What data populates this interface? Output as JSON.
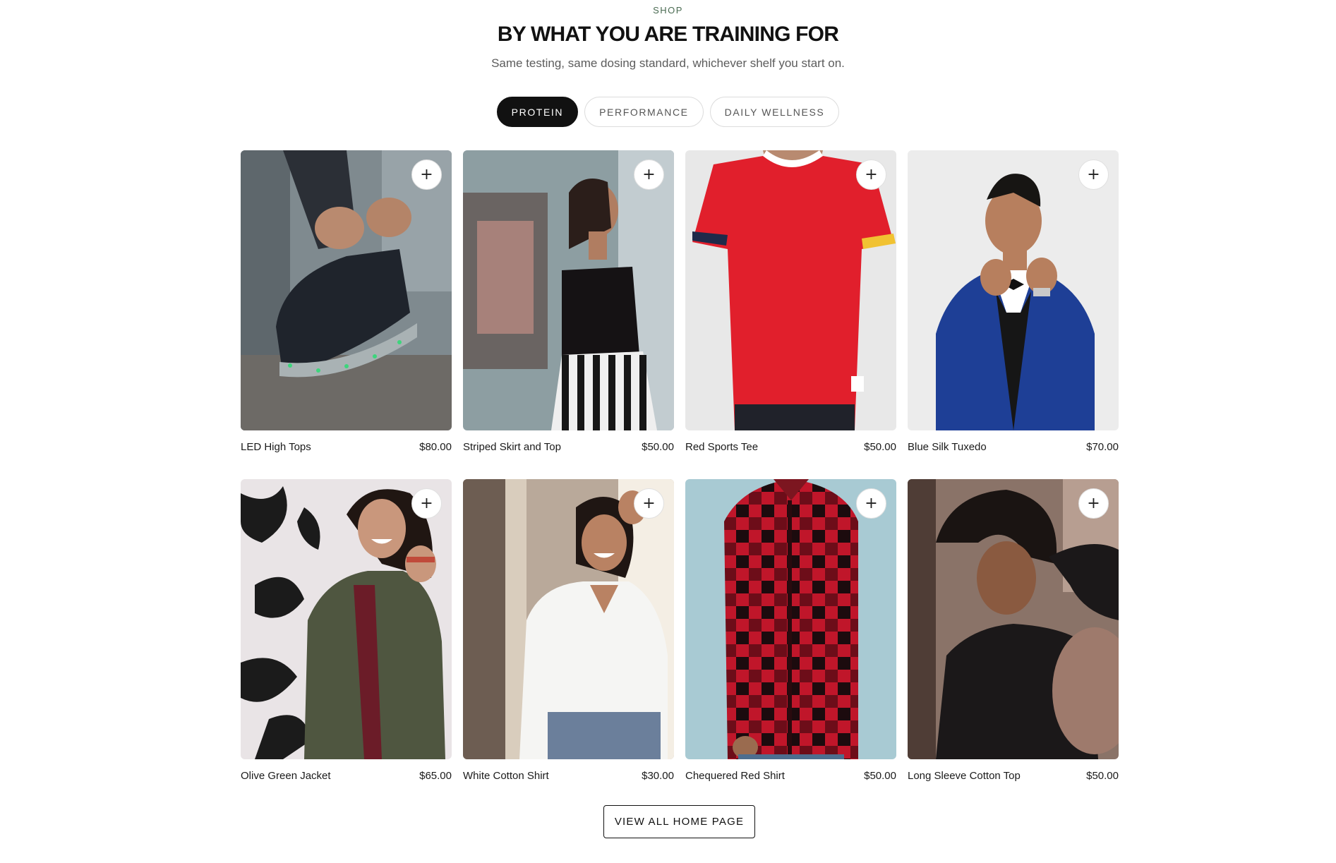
{
  "header": {
    "eyebrow": "SHOP",
    "title": "BY WHAT YOU ARE TRAINING FOR",
    "subtitle": "Same testing, same dosing standard, whichever shelf you start on."
  },
  "tabs": [
    {
      "label": "PROTEIN",
      "active": true
    },
    {
      "label": "PERFORMANCE",
      "active": false
    },
    {
      "label": "DAILY WELLNESS",
      "active": false
    }
  ],
  "add_icon": "+",
  "products": [
    {
      "name": "LED High Tops",
      "price": "$80.00"
    },
    {
      "name": "Striped Skirt and Top",
      "price": "$50.00"
    },
    {
      "name": "Red Sports Tee",
      "price": "$50.00"
    },
    {
      "name": "Blue Silk Tuxedo",
      "price": "$70.00"
    },
    {
      "name": "Olive Green Jacket",
      "price": "$65.00"
    },
    {
      "name": "White Cotton Shirt",
      "price": "$30.00"
    },
    {
      "name": "Chequered Red Shirt",
      "price": "$50.00"
    },
    {
      "name": "Long Sleeve Cotton Top",
      "price": "$50.00"
    }
  ],
  "footer": {
    "view_all_label": "VIEW ALL HOME PAGE"
  }
}
